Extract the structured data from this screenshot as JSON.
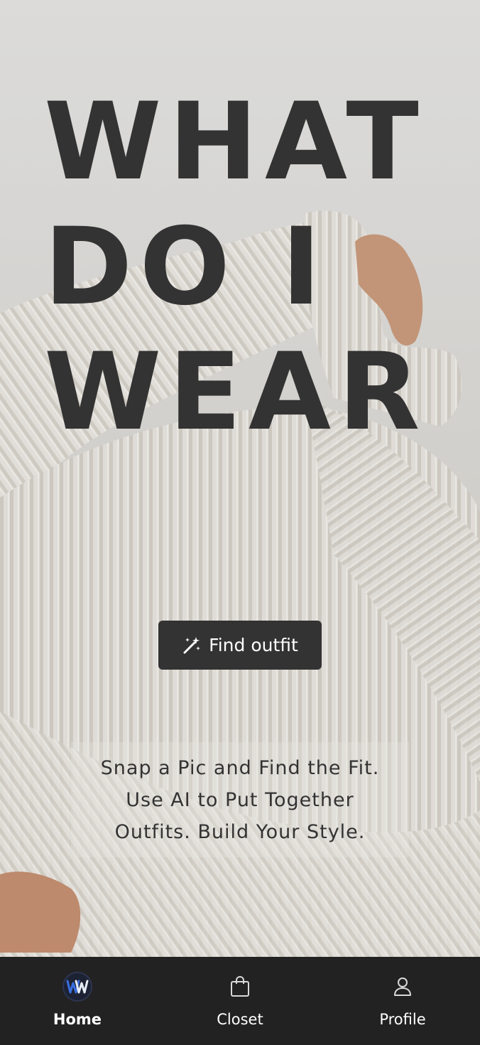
{
  "hero": {
    "headline": [
      "WHAT",
      "DO I",
      "WEAR"
    ],
    "cta_label": "Find outfit",
    "cta_icon": "magic-wand-icon",
    "tagline": [
      "Snap a Pic and Find the Fit.",
      "Use AI to Put Together",
      "Outfits. Build Your Style."
    ]
  },
  "nav": {
    "items": [
      {
        "label": "Home",
        "icon": "logo-icon",
        "active": true
      },
      {
        "label": "Closet",
        "icon": "shopping-bag-icon",
        "active": false
      },
      {
        "label": "Profile",
        "icon": "user-icon",
        "active": false
      }
    ]
  },
  "colors": {
    "text_dark": "#333333",
    "nav_bg": "#222222",
    "button_bg": "#333333",
    "logo_blue": "#3b6fe0"
  }
}
